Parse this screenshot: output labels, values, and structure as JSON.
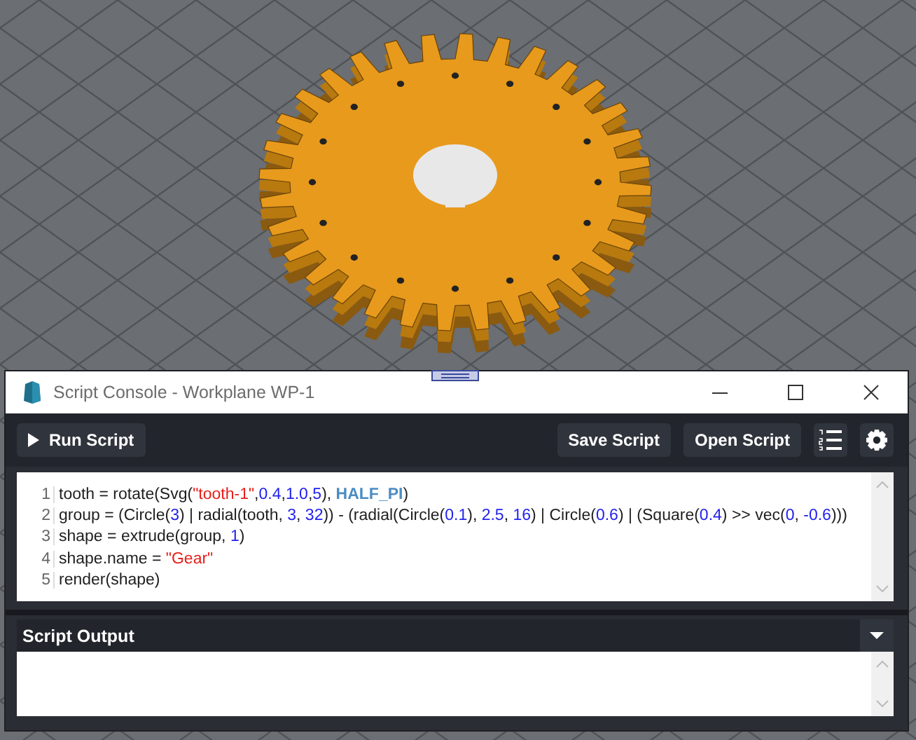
{
  "window": {
    "title": "Script Console - Workplane WP-1"
  },
  "toolbar": {
    "left_buttons": [
      {
        "label": "Run Script",
        "kind": "run"
      }
    ],
    "right_buttons": [
      {
        "label": "Save Script"
      },
      {
        "label": "Open Script"
      }
    ]
  },
  "editor": {
    "lines": [
      {
        "number": "1",
        "tokens": [
          {
            "kind": "plain",
            "text": "tooth = rotate(Svg("
          },
          {
            "kind": "string",
            "text": "\"tooth-1\""
          },
          {
            "kind": "plain",
            "text": ","
          },
          {
            "kind": "number",
            "text": "0.4"
          },
          {
            "kind": "plain",
            "text": ","
          },
          {
            "kind": "number",
            "text": "1.0"
          },
          {
            "kind": "plain",
            "text": ","
          },
          {
            "kind": "number",
            "text": "5"
          },
          {
            "kind": "plain",
            "text": "), "
          },
          {
            "kind": "constant",
            "text": "HALF_PI"
          },
          {
            "kind": "plain",
            "text": ")"
          }
        ]
      },
      {
        "number": "2",
        "tokens": [
          {
            "kind": "plain",
            "text": "group = (Circle("
          },
          {
            "kind": "number",
            "text": "3"
          },
          {
            "kind": "plain",
            "text": ") | radial(tooth, "
          },
          {
            "kind": "number",
            "text": "3"
          },
          {
            "kind": "plain",
            "text": ", "
          },
          {
            "kind": "number",
            "text": "32"
          },
          {
            "kind": "plain",
            "text": ")) - (radial(Circle("
          },
          {
            "kind": "number",
            "text": "0.1"
          },
          {
            "kind": "plain",
            "text": "), "
          },
          {
            "kind": "number",
            "text": "2.5"
          },
          {
            "kind": "plain",
            "text": ", "
          },
          {
            "kind": "number",
            "text": "16"
          },
          {
            "kind": "plain",
            "text": ") | Circle("
          },
          {
            "kind": "number",
            "text": "0.6"
          },
          {
            "kind": "plain",
            "text": ") | (Square("
          },
          {
            "kind": "number",
            "text": "0.4"
          },
          {
            "kind": "plain",
            "text": ") >> vec("
          },
          {
            "kind": "number",
            "text": "0"
          },
          {
            "kind": "plain",
            "text": ", "
          },
          {
            "kind": "number",
            "text": "-0.6"
          },
          {
            "kind": "plain",
            "text": ")))"
          }
        ]
      },
      {
        "number": "3",
        "tokens": [
          {
            "kind": "plain",
            "text": "shape = extrude(group, "
          },
          {
            "kind": "number",
            "text": "1"
          },
          {
            "kind": "plain",
            "text": ")"
          }
        ]
      },
      {
        "number": "4",
        "tokens": [
          {
            "kind": "plain",
            "text": "shape.name = "
          },
          {
            "kind": "string",
            "text": "\"Gear\""
          }
        ]
      },
      {
        "number": "5",
        "tokens": [
          {
            "kind": "plain",
            "text": "render(shape)"
          }
        ]
      }
    ]
  },
  "output_panel": {
    "title": "Script Output"
  }
}
